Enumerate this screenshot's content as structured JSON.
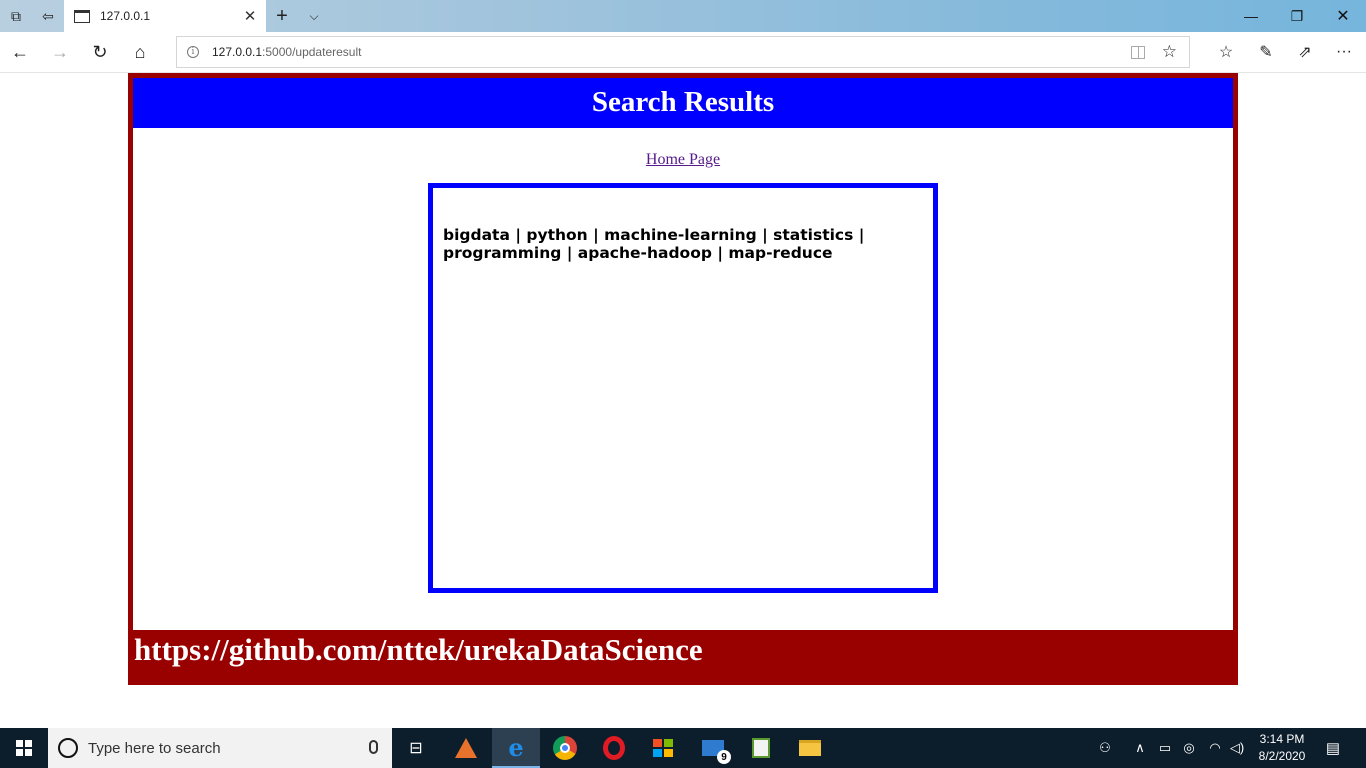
{
  "browser": {
    "tab_title": "127.0.0.1",
    "url_host": "127.0.0.1",
    "url_path": ":5000/updateresult"
  },
  "page": {
    "header_title": "Search Results",
    "home_link": "Home Page",
    "results_text": "bigdata | python | machine-learning | statistics | programming | apache-hadoop | map-reduce",
    "footer_text": "https://github.com/nttek/urekaDataScience"
  },
  "taskbar": {
    "search_placeholder": "Type here to search",
    "mail_badge": "9",
    "time": "3:14 PM",
    "date": "8/2/2020"
  },
  "colors": {
    "header_bg": "#0000ff",
    "frame": "#990000",
    "results_border": "#0000ff"
  }
}
